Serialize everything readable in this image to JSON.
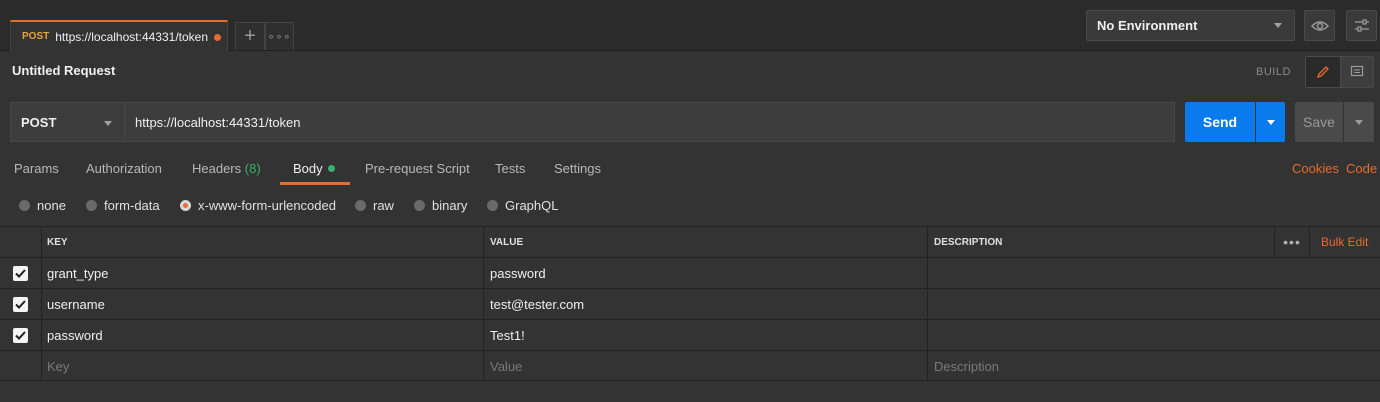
{
  "tab": {
    "method": "POST",
    "title": "https://localhost:44331/token"
  },
  "environment": {
    "selected": "No Environment"
  },
  "request": {
    "name": "Untitled Request",
    "mode_label": "BUILD"
  },
  "url_bar": {
    "method": "POST",
    "url": "https://localhost:44331/token",
    "send_label": "Send",
    "save_label": "Save"
  },
  "request_tabs": {
    "params": "Params",
    "authorization": "Authorization",
    "headers": "Headers",
    "headers_count": "(8)",
    "body": "Body",
    "prerequest": "Pre-request Script",
    "tests": "Tests",
    "settings": "Settings",
    "cookies": "Cookies",
    "code": "Code"
  },
  "body_types": {
    "none": "none",
    "form_data": "form-data",
    "urlencoded": "x-www-form-urlencoded",
    "raw": "raw",
    "binary": "binary",
    "graphql": "GraphQL",
    "selected": "x-www-form-urlencoded"
  },
  "table": {
    "headers": {
      "key": "KEY",
      "value": "VALUE",
      "description": "DESCRIPTION",
      "bulk_edit": "Bulk Edit"
    },
    "rows": [
      {
        "key": "grant_type",
        "value": "password",
        "description": "",
        "checked": true
      },
      {
        "key": "username",
        "value": "test@tester.com",
        "description": "",
        "checked": true
      },
      {
        "key": "password",
        "value": "Test1!",
        "description": "",
        "checked": true
      }
    ],
    "placeholders": {
      "key": "Key",
      "value": "Value",
      "description": "Description"
    }
  },
  "colors": {
    "accent": "#e86c2e",
    "send": "#097bed",
    "success": "#3ab26c",
    "background": "#333333"
  }
}
